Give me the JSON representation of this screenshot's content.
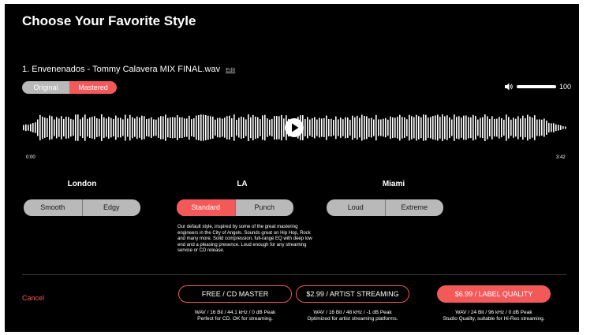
{
  "title": "Choose Your Favorite Style",
  "track": {
    "name": "1. Envenenados - Tommy Calavera MIX FINAL.wav",
    "edit_label": "Edit"
  },
  "view_toggle": {
    "original_label": "Original",
    "mastered_label": "Mastered",
    "selected": "Mastered"
  },
  "volume": {
    "value": "100",
    "level": 1.0,
    "icon": "speaker-icon"
  },
  "player": {
    "time_start": "0:00",
    "time_end": "3:42",
    "icon": "play-icon"
  },
  "styles": [
    {
      "name": "London",
      "options": [
        "Smooth",
        "Edgy"
      ],
      "selected": null
    },
    {
      "name": "LA",
      "options": [
        "Standard",
        "Punch"
      ],
      "selected": "Standard"
    },
    {
      "name": "Miami",
      "options": [
        "Loud",
        "Extreme"
      ],
      "selected": null
    }
  ],
  "description": "Our default style, inspired by some of the great mastering engineers in the City of Angels. Sounds great on Hip Hop, Rock and many more. Solid compression, full-range EQ with deep low end and a pleasing presence. Loud enough for any streaming service or CD release.",
  "cancel_label": "Cancel",
  "plans": [
    {
      "label": "FREE / CD MASTER",
      "spec": "WAV / 16 Bit / 44.1 kHz / 0 dB Peak",
      "note": "Perfect for CD. OK for streaming.",
      "style": "outline"
    },
    {
      "label": "$2.99 / ARTIST STREAMING",
      "spec": "WAV / 16 Bit / 48 kHz / -1 dB Peak",
      "note": "Optimized for artist streaming platforms.",
      "style": "outline"
    },
    {
      "label": "$6.99 / LABEL QUALITY",
      "spec": "WAV / 24 Bit / 96 kHz / 0 dB Peak",
      "note": "Studio Quality, suitable for Hi-Res streaming.",
      "style": "solid"
    }
  ],
  "colors": {
    "accent": "#f4595a",
    "background": "#000000",
    "toggle_inactive": "#b9b9b9"
  }
}
